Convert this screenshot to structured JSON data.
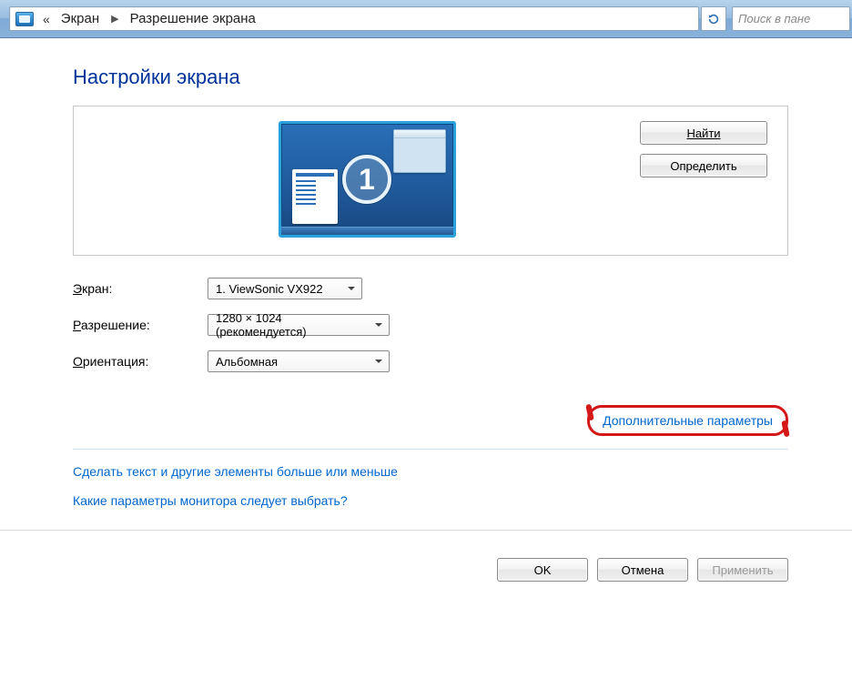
{
  "nav": {
    "breadcrumb1": "Экран",
    "breadcrumb2": "Разрешение экрана",
    "back_arrows": "«",
    "search_placeholder": "Поиск в пане"
  },
  "page": {
    "title": "Настройки экрана"
  },
  "preview": {
    "monitor_number": "1",
    "find": "Найти",
    "detect": "Определить"
  },
  "settings": {
    "screen_label": "Экран:",
    "screen_value": "1. ViewSonic VX922",
    "resolution_label": "Разрешение:",
    "resolution_value": "1280 × 1024 (рекомендуется)",
    "orientation_label": "Ориентация:",
    "orientation_value": "Альбомная"
  },
  "links": {
    "advanced": "Дополнительные параметры",
    "text_size": "Сделать текст и другие элементы больше или меньше",
    "which_settings": "Какие параметры монитора следует выбрать?"
  },
  "footer": {
    "ok": "OK",
    "cancel": "Отмена",
    "apply": "Применить"
  }
}
